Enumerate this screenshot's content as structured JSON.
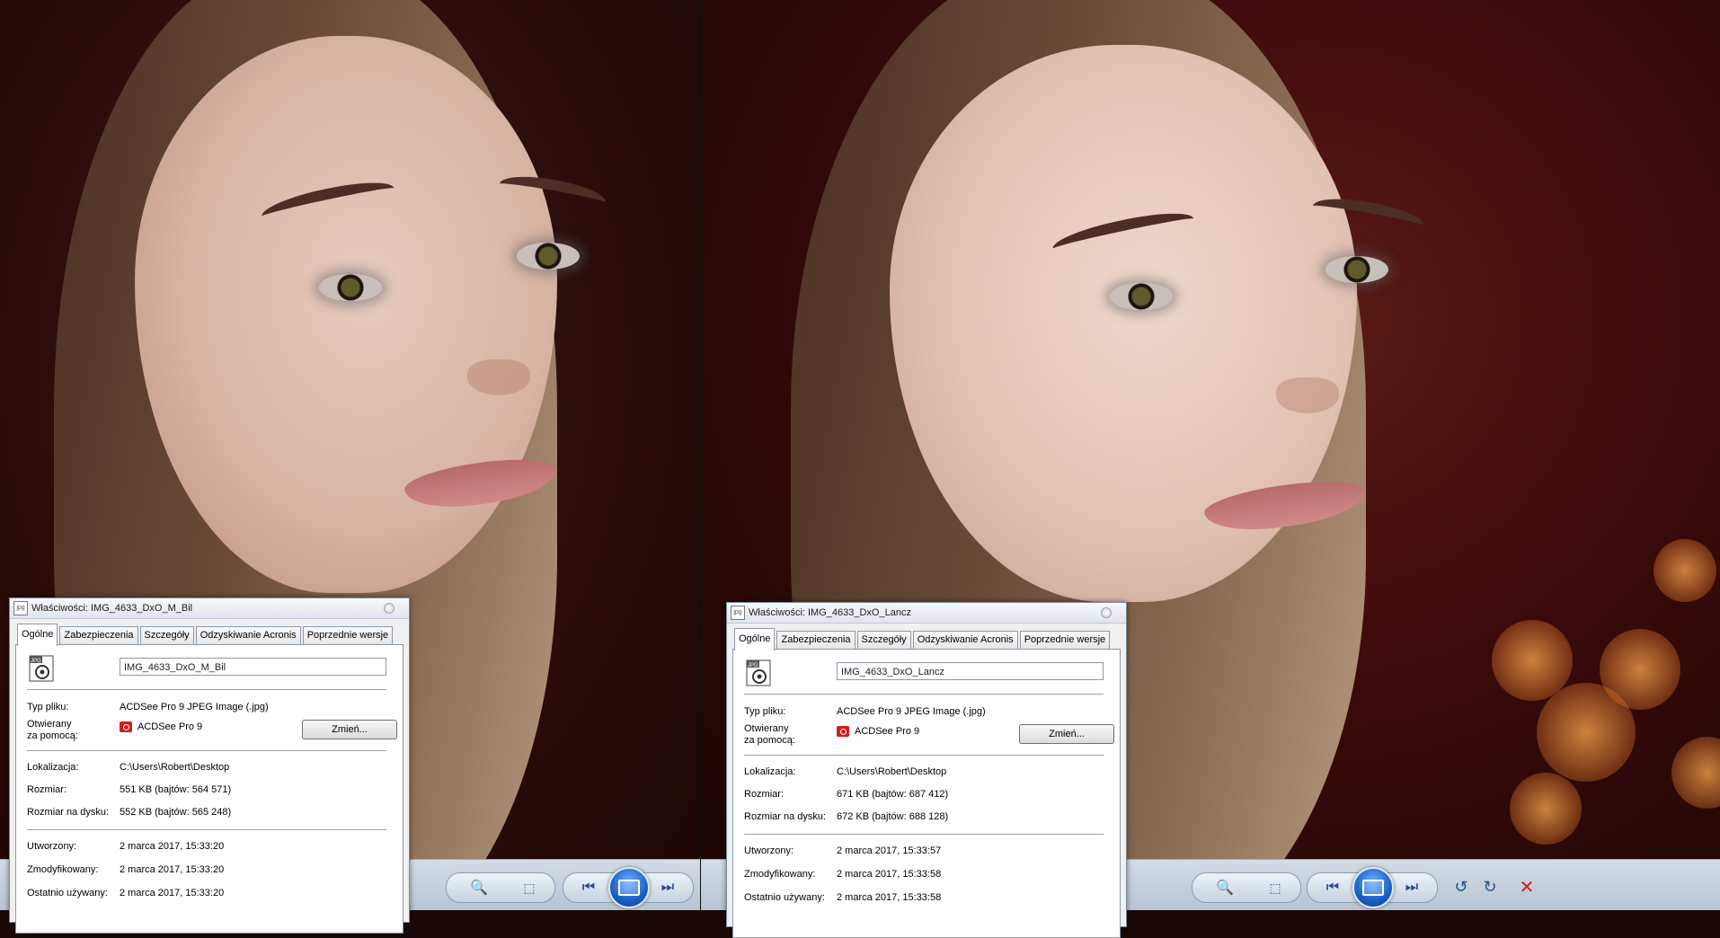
{
  "left_dialog": {
    "title": "Właściwości: IMG_4633_DxO_M_Bil",
    "tabs": [
      "Ogólne",
      "Zabezpieczenia",
      "Szczegóły",
      "Odzyskiwanie Acronis",
      "Poprzednie wersje"
    ],
    "file_name": "IMG_4633_DxO_M_Bil",
    "type_label": "Typ pliku:",
    "type_value": "ACDSee Pro 9 JPEG Image (.jpg)",
    "opens_label_1": "Otwierany",
    "opens_label_2": "za pomocą:",
    "opens_value": "ACDSee Pro 9",
    "change_button": "Zmień...",
    "location_label": "Lokalizacja:",
    "location_value": "C:\\Users\\Robert\\Desktop",
    "size_label": "Rozmiar:",
    "size_value": "551 KB (bajtów: 564 571)",
    "size_on_disk_label": "Rozmiar na dysku:",
    "size_on_disk_value": "552 KB (bajtów: 565 248)",
    "created_label": "Utworzony:",
    "created_value": "2 marca 2017, 15:33:20",
    "modified_label": "Zmodyfikowany:",
    "modified_value": "2 marca 2017, 15:33:20",
    "accessed_label": "Ostatnio używany:",
    "accessed_value": "2 marca 2017, 15:33:20"
  },
  "right_dialog": {
    "title": "Właściwości: IMG_4633_DxO_Lancz",
    "tabs": [
      "Ogólne",
      "Zabezpieczenia",
      "Szczegóły",
      "Odzyskiwanie Acronis",
      "Poprzednie wersje"
    ],
    "file_name": "IMG_4633_DxO_Lancz",
    "type_label": "Typ pliku:",
    "type_value": "ACDSee Pro 9 JPEG Image (.jpg)",
    "opens_label_1": "Otwierany",
    "opens_label_2": "za pomocą:",
    "opens_value": "ACDSee Pro 9",
    "change_button": "Zmień...",
    "location_label": "Lokalizacja:",
    "location_value": "C:\\Users\\Robert\\Desktop",
    "size_label": "Rozmiar:",
    "size_value": "671 KB (bajtów: 687 412)",
    "size_on_disk_label": "Rozmiar na dysku:",
    "size_on_disk_value": "672 KB (bajtów: 688 128)",
    "created_label": "Utworzony:",
    "created_value": "2 marca 2017, 15:33:57",
    "modified_label": "Zmodyfikowany:",
    "modified_value": "2 marca 2017, 15:33:58",
    "accessed_label": "Ostatnio używany:",
    "accessed_value": "2 marca 2017, 15:33:58"
  },
  "toolbar_icons": {
    "zoom": "zoom-icon",
    "fit": "fit-window-icon",
    "prev": "previous-icon",
    "slideshow": "slideshow-icon",
    "next": "next-icon",
    "rotate_left": "rotate-left-icon",
    "rotate_right": "rotate-right-icon",
    "delete": "delete-icon"
  },
  "colors": {
    "toolbar_accent": "#1f4f8f",
    "delete_red": "#cc2020",
    "app_icon_red": "#d81b1b"
  }
}
